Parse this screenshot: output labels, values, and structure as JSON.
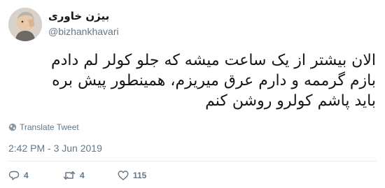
{
  "tweet": {
    "author": {
      "display_name": "بیژن خاوری",
      "handle": "@bizhankhavari"
    },
    "body_lines": [
      "الان بیشتر از یک ساعت میشه که جلو کولر لم دادم",
      "بازم گرممه و دارم عرق میریزم، همینطور پیش بره",
      "باید پاشم کولرو روشن کنم"
    ],
    "translate_label": "Translate Tweet",
    "timestamp": "2:42 PM - 3 Jun 2019",
    "actions": {
      "replies": "4",
      "retweets": "4",
      "likes": "115"
    }
  },
  "colors": {
    "text": "#14171a",
    "secondary": "#657786",
    "divider": "#e6ecf0"
  },
  "icons": {
    "avatar": "avatar-photo",
    "translate": "globe-icon",
    "reply": "reply-icon",
    "retweet": "retweet-icon",
    "like": "heart-icon"
  }
}
